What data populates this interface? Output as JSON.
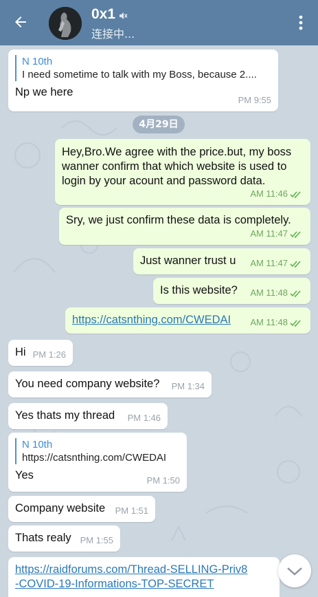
{
  "header": {
    "title": "0x1",
    "subtitle": "连接中..."
  },
  "date_separator": "4月29日",
  "messages": [
    {
      "reply_name": "N 10th",
      "reply_text": "I need sometime to talk with my Boss, because 2....",
      "text": "Np we here",
      "time": "PM 9:55"
    },
    {
      "text_lines": [
        "Hey,Bro.We agree with the price.but, my boss",
        "wanner confirm that which website is used to",
        "login by your  acount and  password data."
      ],
      "time": "AM 11:46"
    },
    {
      "text": "Sry, we just confirm these data is completely.",
      "time": "AM 11:47"
    },
    {
      "text": "Just wanner trust u",
      "time": "AM 11:47"
    },
    {
      "text": "Is this website?",
      "time": "AM 11:48"
    },
    {
      "text": "https://catsnthing.com/CWEDAI",
      "time": "AM 11:48"
    },
    {
      "text": "Hi",
      "time": "PM 1:26"
    },
    {
      "text": "You need company website?",
      "time": "PM 1:34"
    },
    {
      "text": "Yes thats my thread",
      "time": "PM 1:46"
    },
    {
      "reply_name": "N 10th",
      "reply_text": "https://catsnthing.com/CWEDAI",
      "text": "Yes",
      "time": "PM 1:50"
    },
    {
      "text": "Company website",
      "time": "PM 1:51"
    },
    {
      "text": "Thats realy",
      "time": "PM 1:55"
    },
    {
      "text_lines": [
        "https://raidforums.com/Thread-SELLING-Priv8",
        "-COVID-19-Informations-TOP-SECRET"
      ]
    }
  ]
}
